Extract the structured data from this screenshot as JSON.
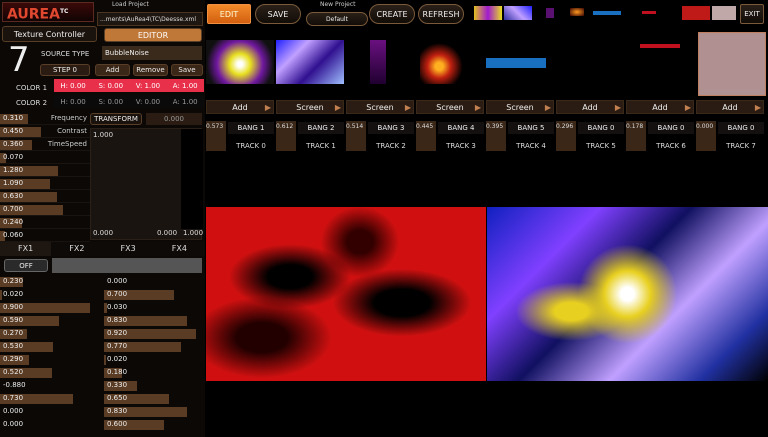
{
  "logo": {
    "text": "AUREA",
    "sup": "TC"
  },
  "top": {
    "load_project_label": "Load Project",
    "load_project_path": "...ments\\AuRea4\\TC\\Deesse.xml",
    "new_project_label": "New Project",
    "new_project_value": "Default",
    "buttons": {
      "edit": "EDIT",
      "save": "SAVE",
      "create": "CREATE",
      "refresh": "REFRESH",
      "exit": "EXIT"
    }
  },
  "left": {
    "title": "Texture Controller",
    "editor": "EDITOR",
    "big_number": "7",
    "source_type_label": "SOURCE TYPE",
    "source_type_value": "BubbleNoise",
    "step_label": "STEP 0",
    "add": "Add",
    "remove": "Remove",
    "save": "Save",
    "color1_label": "COLOR 1",
    "color1": {
      "h": "H: 0.00",
      "s": "S: 0.00",
      "v": "V: 1.00",
      "a": "A: 1.00"
    },
    "color2_label": "COLOR 2",
    "color2": {
      "h": "H: 0.00",
      "s": "S: 0.00",
      "v": "V: 0.00",
      "a": "A: 1.00"
    },
    "params": [
      {
        "value": "0.310",
        "label": "Frequency",
        "fill": 0.31
      },
      {
        "value": "0.450",
        "label": "Contrast",
        "fill": 0.45
      },
      {
        "value": "0.360",
        "label": "TimeSpeed",
        "fill": 0.36
      },
      {
        "value": "0.070",
        "label": "",
        "fill": 0.07
      },
      {
        "value": "1.280",
        "label": "",
        "fill": 0.64
      },
      {
        "value": "1.090",
        "label": "",
        "fill": 0.55
      },
      {
        "value": "0.630",
        "label": "",
        "fill": 0.63
      },
      {
        "value": "0.700",
        "label": "",
        "fill": 0.7
      },
      {
        "value": "0.240",
        "label": "",
        "fill": 0.24
      },
      {
        "value": "0.060",
        "label": "",
        "fill": 0.06
      }
    ],
    "transform_label": "TRANSFORM",
    "transform_value": "0.000",
    "graph": {
      "top": "1.000",
      "bl": "0.000",
      "br": "0.000",
      "right": "1.000"
    },
    "fx_tabs": [
      "FX1",
      "FX2",
      "FX3",
      "FX4"
    ],
    "off": "OFF",
    "fx_col1": [
      {
        "value": "0.230",
        "fill": 0.23
      },
      {
        "value": "0.020",
        "fill": 0.02
      },
      {
        "value": "0.900",
        "fill": 0.9
      },
      {
        "value": "0.590",
        "fill": 0.59
      },
      {
        "value": "0.270",
        "fill": 0.27
      },
      {
        "value": "0.530",
        "fill": 0.53
      },
      {
        "value": "0.290",
        "fill": 0.29
      },
      {
        "value": "0.520",
        "fill": 0.52
      },
      {
        "value": "-0.880",
        "fill": 0.0
      },
      {
        "value": "0.730",
        "fill": 0.73
      },
      {
        "value": "0.000",
        "fill": 0.0
      },
      {
        "value": "0.000",
        "fill": 0.0
      }
    ],
    "fx_col2": [
      {
        "value": "0.000",
        "fill": 0.0
      },
      {
        "value": "0.700",
        "fill": 0.7
      },
      {
        "value": "0.030",
        "fill": 0.03
      },
      {
        "value": "0.830",
        "fill": 0.83
      },
      {
        "value": "0.920",
        "fill": 0.92
      },
      {
        "value": "0.770",
        "fill": 0.77
      },
      {
        "value": "0.020",
        "fill": 0.02
      },
      {
        "value": "0.180",
        "fill": 0.18
      },
      {
        "value": "0.330",
        "fill": 0.33
      },
      {
        "value": "0.650",
        "fill": 0.65
      },
      {
        "value": "0.830",
        "fill": 0.83
      },
      {
        "value": "0.600",
        "fill": 0.6
      }
    ]
  },
  "tracks": [
    {
      "head": "Add",
      "num": "0.573",
      "bang": "BANG 1",
      "name": "TRACK 0"
    },
    {
      "head": "Screen",
      "num": "0.612",
      "bang": "BANG 2",
      "name": "TRACK 1"
    },
    {
      "head": "Screen",
      "num": "0.514",
      "bang": "BANG 3",
      "name": "TRACK 2"
    },
    {
      "head": "Screen",
      "num": "0.445",
      "bang": "BANG 4",
      "name": "TRACK 3"
    },
    {
      "head": "Screen",
      "num": "0.395",
      "bang": "BANG 5",
      "name": "TRACK 4"
    },
    {
      "head": "Add",
      "num": "0.296",
      "bang": "BANG 0",
      "name": "TRACK 5"
    },
    {
      "head": "Add",
      "num": "0.178",
      "bang": "BANG 0",
      "name": "TRACK 6"
    },
    {
      "head": "Add",
      "num": "0.000",
      "bang": "BANG 0",
      "name": "TRACK 7"
    }
  ],
  "colors": {
    "accent": "#e8781c",
    "red": "#e01010",
    "panel": "#2a1c12"
  }
}
